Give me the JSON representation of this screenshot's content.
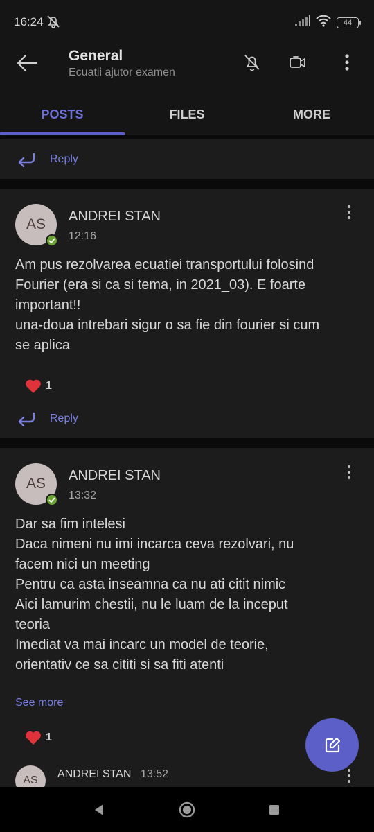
{
  "status_bar": {
    "time": "16:24",
    "battery": "44"
  },
  "header": {
    "title": "General",
    "subtitle": "Ecuatii ajutor examen"
  },
  "tabs": [
    {
      "label": "POSTS",
      "active": true
    },
    {
      "label": "FILES",
      "active": false
    },
    {
      "label": "MORE",
      "active": false
    }
  ],
  "top_reply": {
    "label": "Reply"
  },
  "posts": [
    {
      "avatar_initials": "AS",
      "author": "ANDREI STAN",
      "time": "12:16",
      "lines": [
        "Am pus rezolvarea ecuatiei transportului folosind",
        "Fourier (era si ca si tema, in 2021_03). E foarte",
        "important!!",
        "una-doua intrebari sigur o sa fie din fourier si cum",
        "se aplica"
      ],
      "reaction": {
        "icon": "heart-icon",
        "count": "1"
      },
      "reply_label": "Reply"
    },
    {
      "avatar_initials": "AS",
      "author": "ANDREI STAN",
      "time": "13:32",
      "lines": [
        "Dar sa fim intelesi",
        "Daca nimeni nu imi incarca ceva rezolvari, nu",
        "facem nici un meeting",
        "Pentru ca asta inseamna ca nu ati citit nimic",
        "Aici lamurim chestii, nu le luam de la inceput",
        "teoria",
        "Imediat va mai incarc un model de teorie,",
        "orientativ ce sa cititi si sa fiti atenti"
      ],
      "see_more": "See more",
      "reaction": {
        "icon": "heart-icon",
        "count": "1"
      },
      "nested_reply": {
        "avatar_initials": "AS",
        "author": "ANDREI STAN",
        "time": "13:52"
      }
    }
  ],
  "colors": {
    "accent": "#5b5fc7",
    "link": "#7b80e0",
    "heart": "#e0323b",
    "presence": "#6ba536"
  }
}
